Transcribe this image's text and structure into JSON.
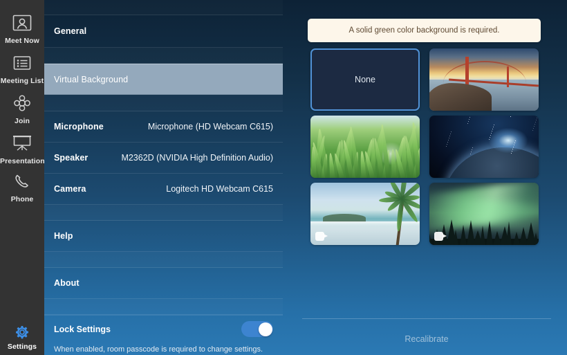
{
  "sidebar": {
    "items": [
      {
        "label": "Meet Now",
        "icon": "person-frame-icon",
        "active": false
      },
      {
        "label": "Meeting List",
        "icon": "list-icon",
        "active": false
      },
      {
        "label": "Join",
        "icon": "join-clover-icon",
        "active": false
      },
      {
        "label": "Presentation",
        "icon": "presentation-screen-icon",
        "active": false
      },
      {
        "label": "Phone",
        "icon": "phone-handset-icon",
        "active": false
      },
      {
        "label": "Settings",
        "icon": "gear-icon",
        "active": true
      }
    ],
    "accent_color": "#3c8ee6",
    "background_color": "#333333"
  },
  "settings": {
    "rows": [
      {
        "label": "General",
        "value": "",
        "type": "nav"
      },
      {
        "label": "Virtual Background",
        "value": "",
        "type": "nav",
        "selected": true
      },
      {
        "label": "Microphone",
        "value": "Microphone (HD Webcam C615)",
        "type": "value"
      },
      {
        "label": "Speaker",
        "value": "M2362D (NVIDIA High Definition Audio)",
        "type": "value"
      },
      {
        "label": "Camera",
        "value": "Logitech HD Webcam C615",
        "type": "value"
      },
      {
        "label": "Help",
        "value": "",
        "type": "nav"
      },
      {
        "label": "About",
        "value": "",
        "type": "nav"
      }
    ],
    "lock": {
      "label": "Lock Settings",
      "toggle_on": true,
      "description": "When enabled, room passcode is required to change settings."
    },
    "highlight_color": "#94a9bc"
  },
  "virtual_background": {
    "banner": "A solid green color background is required.",
    "banner_bg": "#fdf6ea",
    "banner_text_color": "#5f4a33",
    "selection_color": "#5192d6",
    "thumbnails": [
      {
        "name": "None",
        "label": "None",
        "art": "none",
        "selected": true,
        "video": false
      },
      {
        "name": "Golden Gate Bridge",
        "label": "",
        "art": "bridge",
        "selected": false,
        "video": false
      },
      {
        "name": "Grass",
        "label": "",
        "art": "grass",
        "selected": false,
        "video": false
      },
      {
        "name": "Earth from space",
        "label": "",
        "art": "earth",
        "selected": false,
        "video": false
      },
      {
        "name": "Tropical beach",
        "label": "",
        "art": "beach",
        "selected": false,
        "video": true
      },
      {
        "name": "Aurora borealis",
        "label": "",
        "art": "aurora",
        "selected": false,
        "video": true
      }
    ],
    "recalibrate_label": "Recalibrate"
  }
}
